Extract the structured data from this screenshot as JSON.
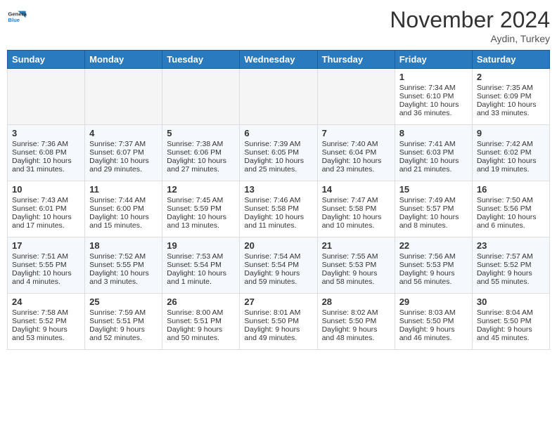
{
  "header": {
    "logo_line1": "General",
    "logo_line2": "Blue",
    "month": "November 2024",
    "location": "Aydin, Turkey"
  },
  "days_of_week": [
    "Sunday",
    "Monday",
    "Tuesday",
    "Wednesday",
    "Thursday",
    "Friday",
    "Saturday"
  ],
  "weeks": [
    [
      {
        "day": "",
        "info": ""
      },
      {
        "day": "",
        "info": ""
      },
      {
        "day": "",
        "info": ""
      },
      {
        "day": "",
        "info": ""
      },
      {
        "day": "",
        "info": ""
      },
      {
        "day": "1",
        "info": "Sunrise: 7:34 AM\nSunset: 6:10 PM\nDaylight: 10 hours and 36 minutes."
      },
      {
        "day": "2",
        "info": "Sunrise: 7:35 AM\nSunset: 6:09 PM\nDaylight: 10 hours and 33 minutes."
      }
    ],
    [
      {
        "day": "3",
        "info": "Sunrise: 7:36 AM\nSunset: 6:08 PM\nDaylight: 10 hours and 31 minutes."
      },
      {
        "day": "4",
        "info": "Sunrise: 7:37 AM\nSunset: 6:07 PM\nDaylight: 10 hours and 29 minutes."
      },
      {
        "day": "5",
        "info": "Sunrise: 7:38 AM\nSunset: 6:06 PM\nDaylight: 10 hours and 27 minutes."
      },
      {
        "day": "6",
        "info": "Sunrise: 7:39 AM\nSunset: 6:05 PM\nDaylight: 10 hours and 25 minutes."
      },
      {
        "day": "7",
        "info": "Sunrise: 7:40 AM\nSunset: 6:04 PM\nDaylight: 10 hours and 23 minutes."
      },
      {
        "day": "8",
        "info": "Sunrise: 7:41 AM\nSunset: 6:03 PM\nDaylight: 10 hours and 21 minutes."
      },
      {
        "day": "9",
        "info": "Sunrise: 7:42 AM\nSunset: 6:02 PM\nDaylight: 10 hours and 19 minutes."
      }
    ],
    [
      {
        "day": "10",
        "info": "Sunrise: 7:43 AM\nSunset: 6:01 PM\nDaylight: 10 hours and 17 minutes."
      },
      {
        "day": "11",
        "info": "Sunrise: 7:44 AM\nSunset: 6:00 PM\nDaylight: 10 hours and 15 minutes."
      },
      {
        "day": "12",
        "info": "Sunrise: 7:45 AM\nSunset: 5:59 PM\nDaylight: 10 hours and 13 minutes."
      },
      {
        "day": "13",
        "info": "Sunrise: 7:46 AM\nSunset: 5:58 PM\nDaylight: 10 hours and 11 minutes."
      },
      {
        "day": "14",
        "info": "Sunrise: 7:47 AM\nSunset: 5:58 PM\nDaylight: 10 hours and 10 minutes."
      },
      {
        "day": "15",
        "info": "Sunrise: 7:49 AM\nSunset: 5:57 PM\nDaylight: 10 hours and 8 minutes."
      },
      {
        "day": "16",
        "info": "Sunrise: 7:50 AM\nSunset: 5:56 PM\nDaylight: 10 hours and 6 minutes."
      }
    ],
    [
      {
        "day": "17",
        "info": "Sunrise: 7:51 AM\nSunset: 5:55 PM\nDaylight: 10 hours and 4 minutes."
      },
      {
        "day": "18",
        "info": "Sunrise: 7:52 AM\nSunset: 5:55 PM\nDaylight: 10 hours and 3 minutes."
      },
      {
        "day": "19",
        "info": "Sunrise: 7:53 AM\nSunset: 5:54 PM\nDaylight: 10 hours and 1 minute."
      },
      {
        "day": "20",
        "info": "Sunrise: 7:54 AM\nSunset: 5:54 PM\nDaylight: 9 hours and 59 minutes."
      },
      {
        "day": "21",
        "info": "Sunrise: 7:55 AM\nSunset: 5:53 PM\nDaylight: 9 hours and 58 minutes."
      },
      {
        "day": "22",
        "info": "Sunrise: 7:56 AM\nSunset: 5:53 PM\nDaylight: 9 hours and 56 minutes."
      },
      {
        "day": "23",
        "info": "Sunrise: 7:57 AM\nSunset: 5:52 PM\nDaylight: 9 hours and 55 minutes."
      }
    ],
    [
      {
        "day": "24",
        "info": "Sunrise: 7:58 AM\nSunset: 5:52 PM\nDaylight: 9 hours and 53 minutes."
      },
      {
        "day": "25",
        "info": "Sunrise: 7:59 AM\nSunset: 5:51 PM\nDaylight: 9 hours and 52 minutes."
      },
      {
        "day": "26",
        "info": "Sunrise: 8:00 AM\nSunset: 5:51 PM\nDaylight: 9 hours and 50 minutes."
      },
      {
        "day": "27",
        "info": "Sunrise: 8:01 AM\nSunset: 5:50 PM\nDaylight: 9 hours and 49 minutes."
      },
      {
        "day": "28",
        "info": "Sunrise: 8:02 AM\nSunset: 5:50 PM\nDaylight: 9 hours and 48 minutes."
      },
      {
        "day": "29",
        "info": "Sunrise: 8:03 AM\nSunset: 5:50 PM\nDaylight: 9 hours and 46 minutes."
      },
      {
        "day": "30",
        "info": "Sunrise: 8:04 AM\nSunset: 5:50 PM\nDaylight: 9 hours and 45 minutes."
      }
    ]
  ]
}
